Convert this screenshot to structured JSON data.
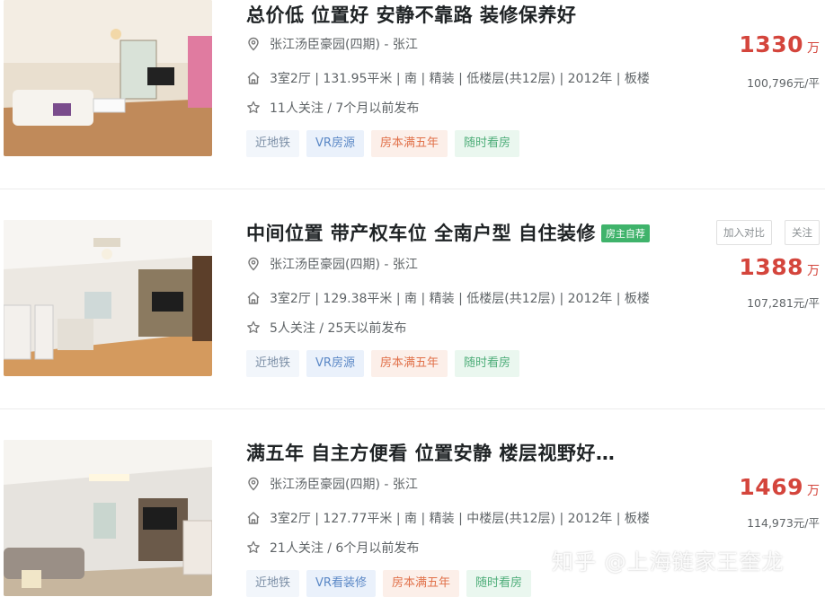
{
  "listings": [
    {
      "title": "总价低 位置好 安静不靠路 装修保养好",
      "community": "张江汤臣豪园(四期) - 张江",
      "info": "3室2厅 | 131.95平米 | 南 | 精装 | 低楼层(共12层) | 2012年 | 板楼",
      "follow": "11人关注 / 7个月以前发布",
      "tags": [
        "近地铁",
        "VR房源",
        "房本满五年",
        "随时看房"
      ],
      "price": "1330",
      "price_unit": "万",
      "unit_price": "100,796元/平"
    },
    {
      "title": "中间位置 带产权车位 全南户型 自住装修",
      "owner_tag": "房主自荐",
      "community": "张江汤臣豪园(四期) - 张江",
      "info": "3室2厅 | 129.38平米 | 南 | 精装 | 低楼层(共12层) | 2012年 | 板楼",
      "follow": "5人关注 / 25天以前发布",
      "tags": [
        "近地铁",
        "VR房源",
        "房本满五年",
        "随时看房"
      ],
      "price": "1388",
      "price_unit": "万",
      "unit_price": "107,281元/平",
      "compare_label": "加入对比",
      "follow_label": "关注"
    },
    {
      "title": "满五年 自主方便看 位置安静 楼层视野好…",
      "community": "张江汤臣豪园(四期) - 张江",
      "info": "3室2厅 | 127.77平米 | 南 | 精装 | 中楼层(共12层) | 2012年 | 板楼",
      "follow": "21人关注 / 6个月以前发布",
      "tags": [
        "近地铁",
        "VR看装修",
        "房本满五年",
        "随时看房"
      ],
      "price": "1469",
      "price_unit": "万",
      "unit_price": "114,973元/平"
    }
  ],
  "watermark": "知乎 @上海链家王奎龙",
  "icons": {
    "location": "location-pin-icon",
    "house": "house-icon",
    "star": "star-icon"
  }
}
